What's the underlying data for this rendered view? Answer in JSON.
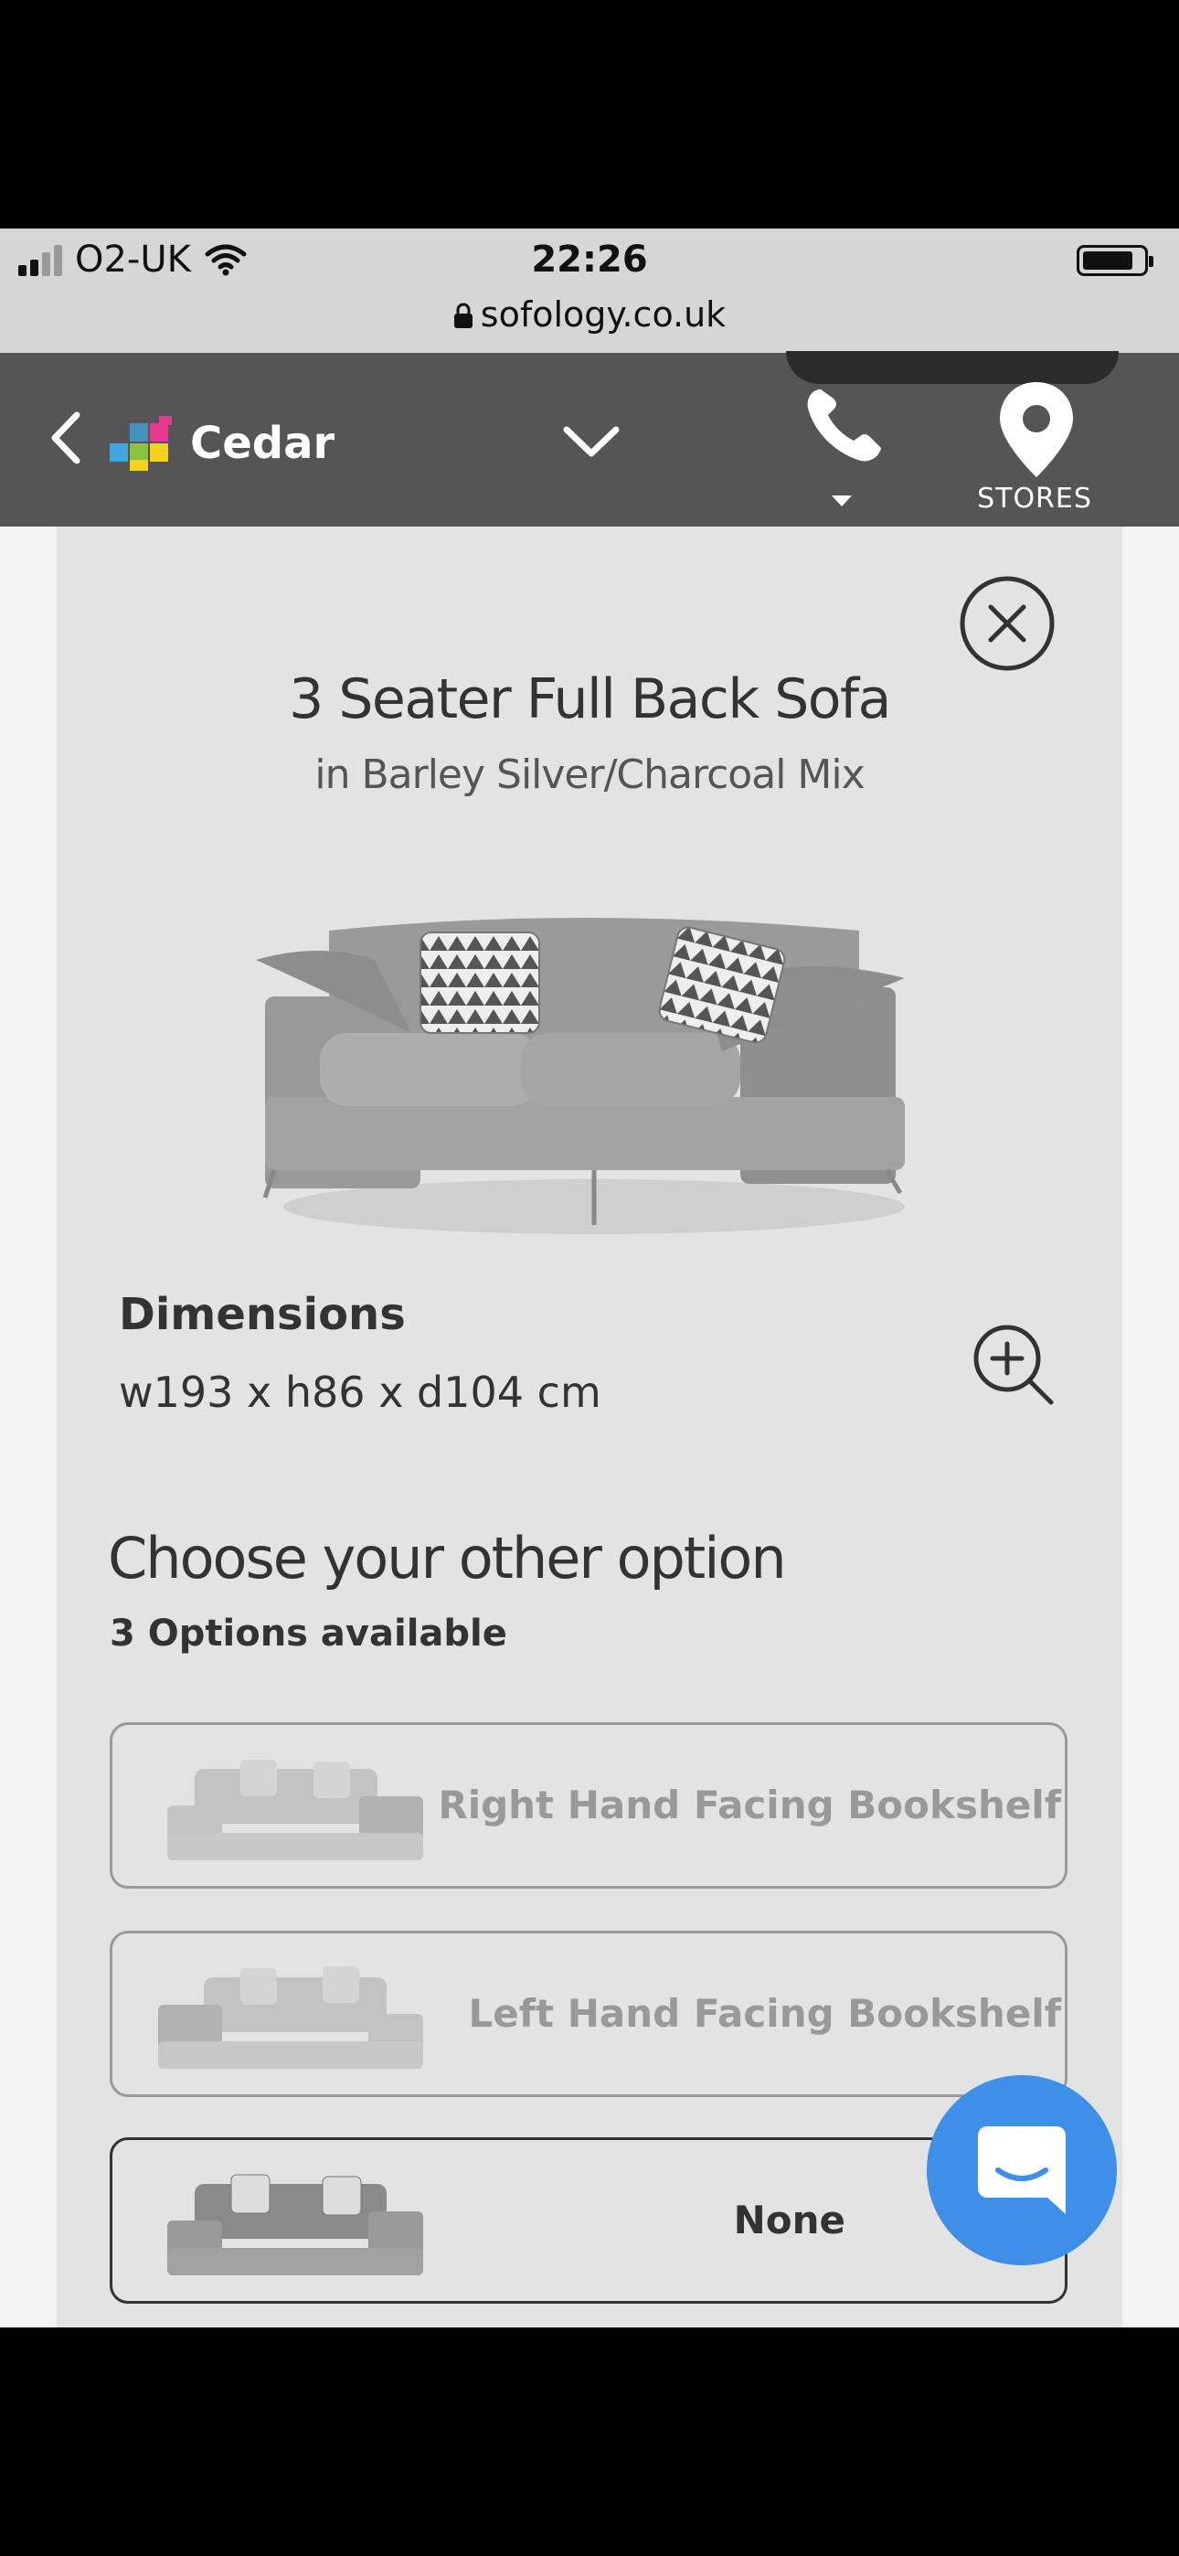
{
  "status_bar": {
    "carrier": "O2-UK",
    "time": "22:26",
    "url": "sofology.co.uk"
  },
  "nav": {
    "brand_name": "Cedar",
    "stores_label": "STORES"
  },
  "product": {
    "title": "3 Seater Full Back Sofa",
    "subtitle": "in Barley Silver/Charcoal Mix",
    "dimensions_heading": "Dimensions",
    "dimensions_value": "w193 x h86 x d104 cm"
  },
  "options": {
    "heading": "Choose your other option",
    "count_label": "3 Options available",
    "items": [
      {
        "label": "Right Hand Facing Bookshelf",
        "selected": false
      },
      {
        "label": "Left Hand Facing Bookshelf",
        "selected": false
      },
      {
        "label": "None",
        "selected": true
      }
    ]
  },
  "colors": {
    "nav_bg": "#555555",
    "panel_bg": "#e3e3e3",
    "chat_bubble": "#3d8fe8",
    "brand_pixels": [
      "#e8378f",
      "#3fa6e0",
      "#f7d21c",
      "#8ac43f"
    ]
  },
  "icons": [
    "back-chevron-icon",
    "brand-logo-icon",
    "dropdown-chevron-icon",
    "phone-icon",
    "map-pin-icon",
    "close-icon",
    "zoom-in-icon",
    "chat-icon",
    "lock-icon",
    "wifi-icon",
    "battery-icon"
  ]
}
